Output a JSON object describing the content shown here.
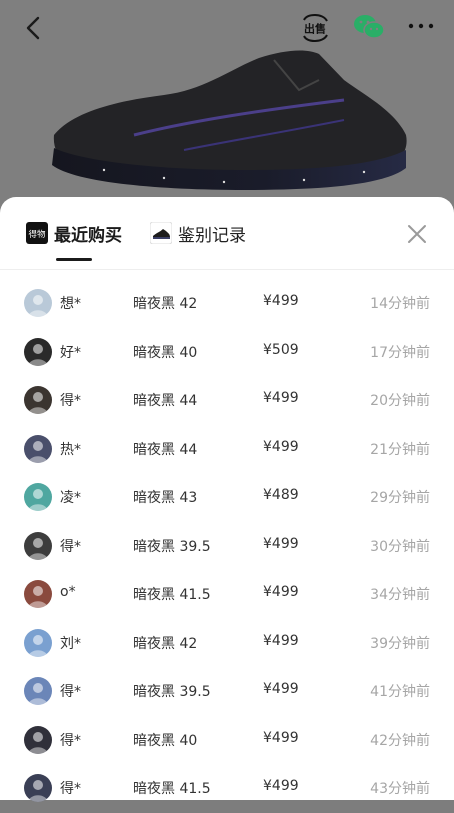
{
  "topbar": {
    "sell_label": "出售"
  },
  "sheet": {
    "tabs": [
      {
        "label": "最近购买",
        "icon_text": "得物",
        "active": true
      },
      {
        "label": "鉴别记录",
        "active": false
      }
    ]
  },
  "purchases": [
    {
      "name": "想*",
      "spec": "暗夜黑 42",
      "price": "¥499",
      "time": "14分钟前",
      "avatar_color": "#b9c9d8"
    },
    {
      "name": "好*",
      "spec": "暗夜黑 40",
      "price": "¥509",
      "time": "17分钟前",
      "avatar_color": "#2a2a2a"
    },
    {
      "name": "得*",
      "spec": "暗夜黑 44",
      "price": "¥499",
      "time": "20分钟前",
      "avatar_color": "#3b3530"
    },
    {
      "name": "热*",
      "spec": "暗夜黑 44",
      "price": "¥499",
      "time": "21分钟前",
      "avatar_color": "#4a4f6b"
    },
    {
      "name": "凌*",
      "spec": "暗夜黑 43",
      "price": "¥489",
      "time": "29分钟前",
      "avatar_color": "#4fa7a0"
    },
    {
      "name": "得*",
      "spec": "暗夜黑 39.5",
      "price": "¥499",
      "time": "30分钟前",
      "avatar_color": "#3d3d3d"
    },
    {
      "name": "o*",
      "spec": "暗夜黑 41.5",
      "price": "¥499",
      "time": "34分钟前",
      "avatar_color": "#8a4a3e"
    },
    {
      "name": "刘*",
      "spec": "暗夜黑 42",
      "price": "¥499",
      "time": "39分钟前",
      "avatar_color": "#7aa0d0"
    },
    {
      "name": "得*",
      "spec": "暗夜黑 39.5",
      "price": "¥499",
      "time": "41分钟前",
      "avatar_color": "#6b86b8"
    },
    {
      "name": "得*",
      "spec": "暗夜黑 40",
      "price": "¥499",
      "time": "42分钟前",
      "avatar_color": "#30303a"
    },
    {
      "name": "得*",
      "spec": "暗夜黑 41.5",
      "price": "¥499",
      "time": "43分钟前",
      "avatar_color": "#3a3f55"
    }
  ]
}
